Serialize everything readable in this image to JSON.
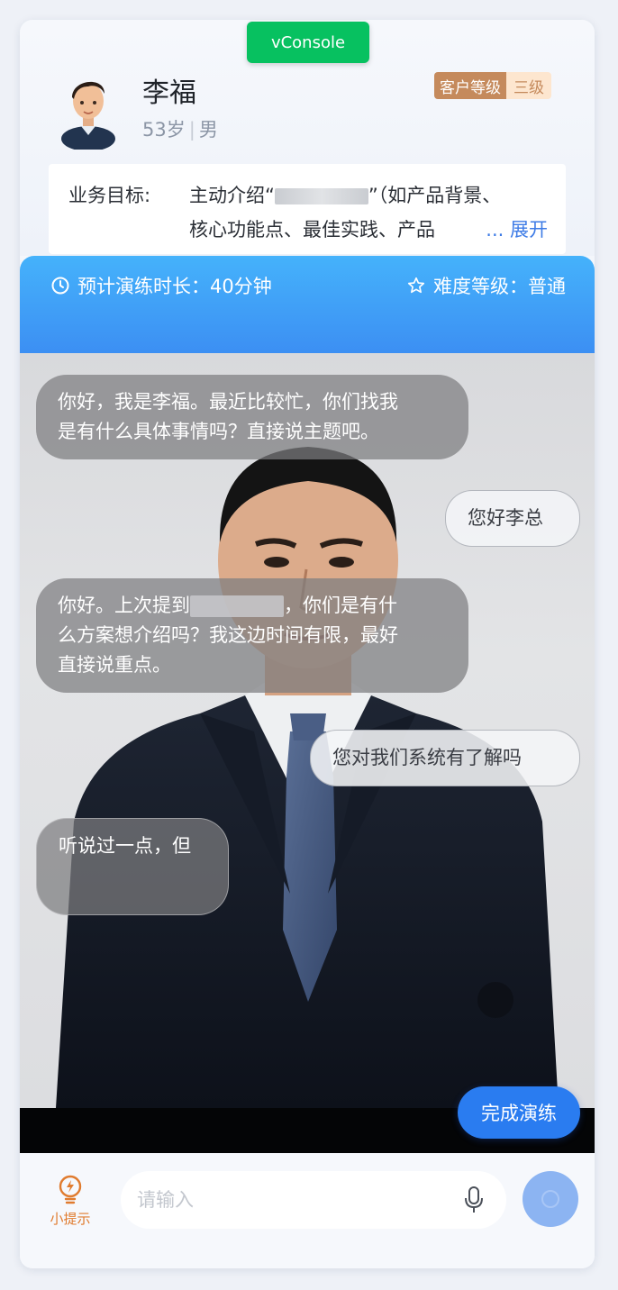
{
  "vconsole": {
    "label": "vConsole"
  },
  "profile": {
    "name": "李福",
    "age": "53岁",
    "gender": "男",
    "level_key": "客户等级",
    "level_value": "三级"
  },
  "goal": {
    "label": "业务目标:",
    "line1_prefix": "主动介绍“",
    "line1_suffix": "”（如产品背景、",
    "line2": "核心功能点、最佳实践、产品",
    "expand": "... 展开"
  },
  "session": {
    "duration": "预计演练时长：40分钟",
    "difficulty": "难度等级：普通"
  },
  "chat": [
    {
      "role": "ai",
      "lines": [
        "你好，我是李福。最近比较忙，你们找我",
        "是有什么具体事情吗？直接说主题吧。"
      ]
    },
    {
      "role": "me",
      "text": "您好李总"
    },
    {
      "role": "ai",
      "line1_prefix": "你好。上次提到",
      "line1_suffix": "，你们是有什",
      "lines": [
        "么方案想介绍吗？我这边时间有限，最好",
        "直接说重点。"
      ]
    },
    {
      "role": "me",
      "text": "您对我们系统有了解吗"
    },
    {
      "role": "ai",
      "text": "听说过一点，但"
    }
  ],
  "actions": {
    "finish": "完成演练"
  },
  "input": {
    "tip_label": "小提示",
    "placeholder": "请输入"
  },
  "colors": {
    "accent": "#2a7cf0",
    "vconsole": "#07c160",
    "tip": "#e07b2e"
  }
}
